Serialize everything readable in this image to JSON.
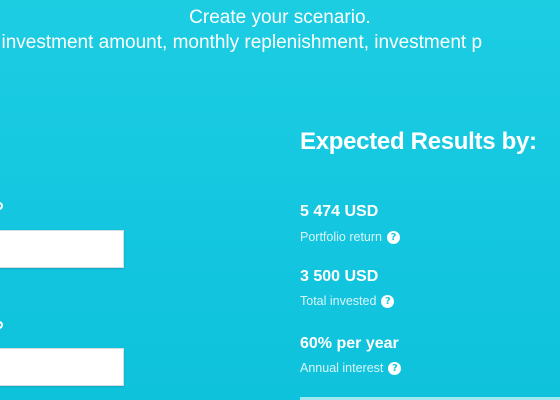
{
  "header": {
    "title": "Create your scenario.",
    "subtitle": "l investment amount, monthly replenishment, investment p"
  },
  "inputs": [
    {
      "value": "",
      "placeholder": ""
    },
    {
      "value": "",
      "placeholder": ""
    }
  ],
  "results": {
    "title": "Expected Results by:",
    "items": [
      {
        "value": "5 474 USD",
        "label": "Portfolio return",
        "icon": "help-icon"
      },
      {
        "value": "3 500 USD",
        "label": "Total invested",
        "icon": "help-icon"
      },
      {
        "value": "60% per year",
        "label": "Annual interest",
        "icon": "help-icon"
      }
    ]
  },
  "colors": {
    "background": "#14c6e0",
    "text": "#ffffff",
    "label": "#d9f6fb"
  }
}
